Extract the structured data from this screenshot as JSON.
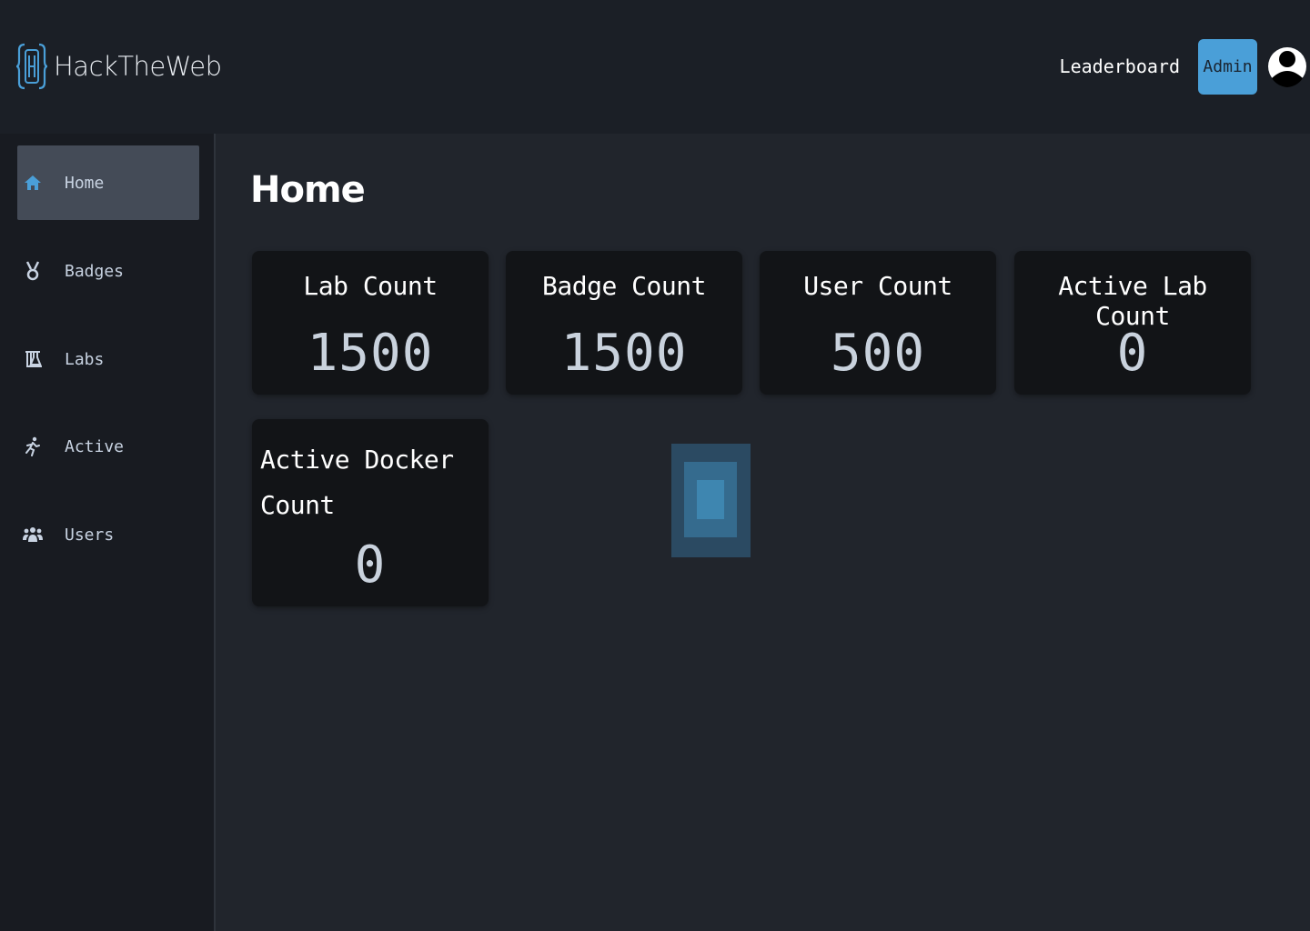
{
  "header": {
    "brand_name": "HackTheWeb",
    "leaderboard_label": "Leaderboard",
    "admin_label": "Admin"
  },
  "sidebar": {
    "items": [
      {
        "label": "Home",
        "icon": "home-icon",
        "active": true
      },
      {
        "label": "Badges",
        "icon": "medal-icon",
        "active": false
      },
      {
        "label": "Labs",
        "icon": "flask-icon",
        "active": false
      },
      {
        "label": "Active",
        "icon": "running-icon",
        "active": false
      },
      {
        "label": "Users",
        "icon": "users-icon",
        "active": false
      }
    ]
  },
  "main": {
    "title": "Home",
    "cards": [
      {
        "label": "Lab Count",
        "value": "1500"
      },
      {
        "label": "Badge Count",
        "value": "1500"
      },
      {
        "label": "User Count",
        "value": "500"
      },
      {
        "label": "Active Lab Count",
        "value": "0"
      },
      {
        "label": "Active Docker Count",
        "value": "0"
      }
    ]
  },
  "colors": {
    "accent": "#4a9fd8",
    "background": "#21252c",
    "sidebar": "#181b21",
    "card": "#121417"
  }
}
